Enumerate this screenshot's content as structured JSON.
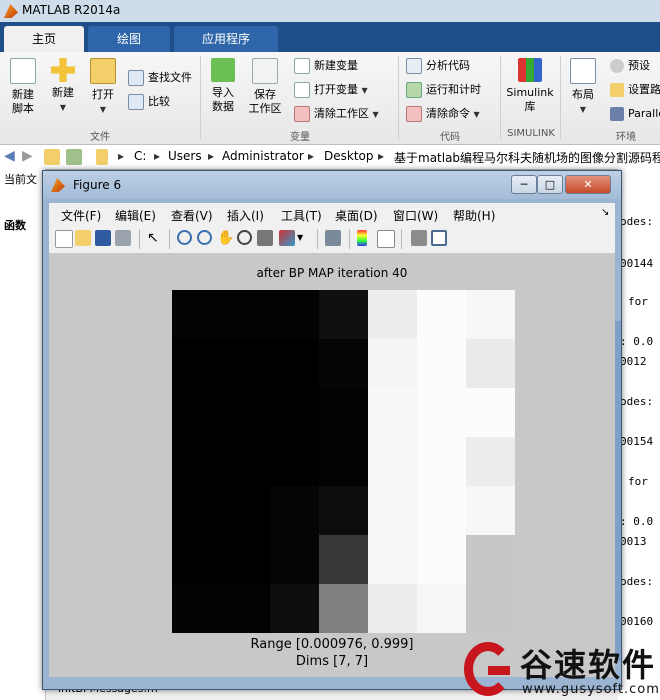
{
  "app": {
    "title": "MATLAB R2014a"
  },
  "tabs": [
    {
      "label": "主页",
      "active": true
    },
    {
      "label": "绘图"
    },
    {
      "label": "应用程序"
    }
  ],
  "ribbon": {
    "file": {
      "new_script": "新建\n脚本",
      "new": "新建",
      "open": "打开",
      "find_files": "查找文件",
      "compare": "比较",
      "label": "文件"
    },
    "variable": {
      "import": "导入\n数据",
      "save_ws": "保存\n工作区",
      "new_var": "新建变量",
      "open_var": "打开变量",
      "clear_ws": "清除工作区",
      "label": "变量"
    },
    "code": {
      "analyze": "分析代码",
      "run_time": "运行和计时",
      "clear_cmd": "清除命令",
      "label": "代码"
    },
    "simulink": {
      "button": "Simulink\n库",
      "label": "SIMULINK"
    },
    "env": {
      "layout": "布局",
      "prefs": "预设",
      "set_path": "设置路",
      "parallel": "Paralle",
      "label": "环境"
    }
  },
  "address": {
    "crumbs": [
      "C:",
      "Users",
      "Administrator",
      "Desktop",
      "基于matlab编程马尔科夫随机场的图像分割源码程"
    ]
  },
  "left_panel": {
    "current_folder": "当前文",
    "functions": "函数",
    "file": "initBPMessages.m"
  },
  "command_window": {
    "lines": [
      "odes:",
      "00144",
      "for",
      ": 0.0",
      "0012",
      "odes:",
      "00154",
      "for",
      ": 0.0",
      "0013",
      "odes:",
      "00160"
    ]
  },
  "figure": {
    "title": "Figure 6",
    "menus": [
      "文件(F)",
      "编辑(E)",
      "查看(V)",
      "插入(I)",
      "工具(T)",
      "桌面(D)",
      "窗口(W)",
      "帮助(H)"
    ],
    "plot_title": "after BP MAP iteration 40",
    "range_label": "Range [0.000976, 0.999]",
    "dims_label": "Dims [7, 7]",
    "image_values": [
      [
        0.01,
        0.01,
        0.01,
        0.06,
        0.93,
        0.99,
        0.97
      ],
      [
        0.0,
        0.0,
        0.0,
        0.02,
        0.96,
        0.99,
        0.92
      ],
      [
        0.0,
        0.0,
        0.0,
        0.01,
        0.97,
        0.99,
        0.99
      ],
      [
        0.0,
        0.0,
        0.0,
        0.01,
        0.97,
        0.99,
        0.93
      ],
      [
        0.0,
        0.0,
        0.02,
        0.05,
        0.97,
        0.99,
        0.97
      ],
      [
        0.0,
        0.0,
        0.02,
        0.22,
        0.97,
        0.99,
        0.78
      ],
      [
        0.01,
        0.01,
        0.05,
        0.5,
        0.93,
        0.97,
        0.78
      ]
    ]
  },
  "watermark": {
    "text": "谷速软件",
    "url": "www.gusysoft.com"
  },
  "colors": {
    "accent": "#1f4f8a",
    "figure_frame": "#9ab4d2",
    "watermark_red": "#c7161d"
  }
}
